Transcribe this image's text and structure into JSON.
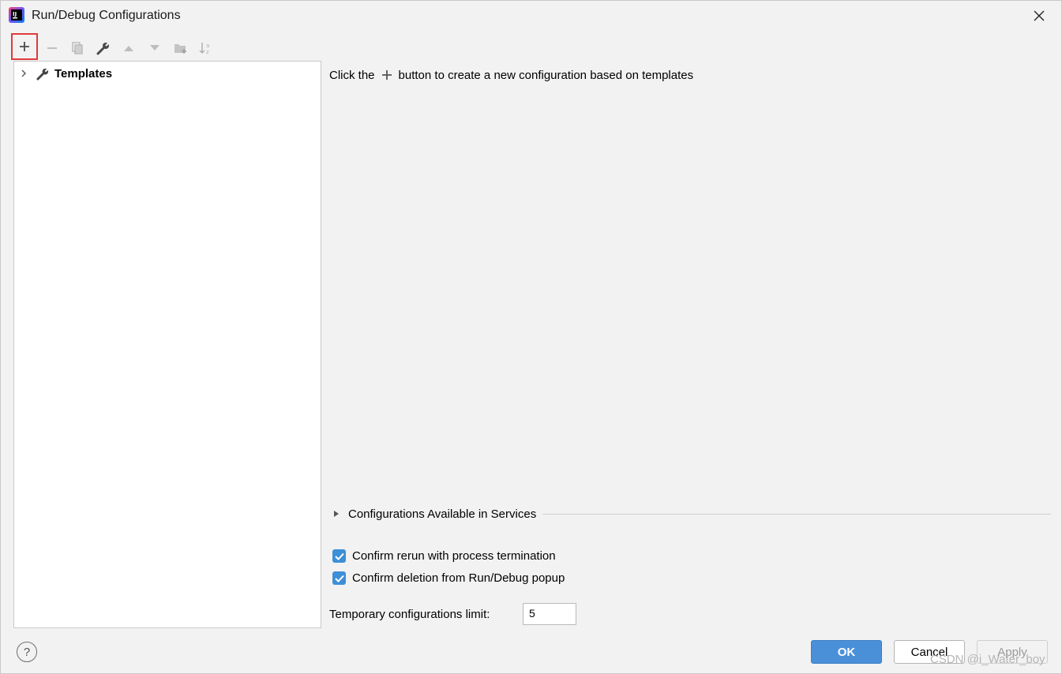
{
  "window": {
    "title": "Run/Debug Configurations"
  },
  "toolbar": {
    "buttons": [
      {
        "name": "add-icon",
        "enabled": true,
        "highlighted": true
      },
      {
        "name": "remove-icon",
        "enabled": false
      },
      {
        "name": "copy-icon",
        "enabled": false
      },
      {
        "name": "wrench-icon",
        "enabled": true
      },
      {
        "name": "move-up-icon",
        "enabled": false
      },
      {
        "name": "move-down-icon",
        "enabled": false
      },
      {
        "name": "new-folder-icon",
        "enabled": false
      },
      {
        "name": "sort-alpha-icon",
        "enabled": false
      }
    ],
    "highlight_color": "#e03a3a"
  },
  "tree": {
    "root_label": "Templates"
  },
  "main": {
    "hint_before": "Click the",
    "hint_after": "button to create a new configuration based on templates",
    "services_label": "Configurations Available in Services",
    "confirm_rerun_label": "Confirm rerun with process termination",
    "confirm_rerun_checked": true,
    "confirm_deletion_label": "Confirm deletion from Run/Debug popup",
    "confirm_deletion_checked": true,
    "temp_limit_label": "Temporary configurations limit:",
    "temp_limit_value": "5"
  },
  "footer": {
    "help_label": "?",
    "ok_label": "OK",
    "cancel_label": "Cancel",
    "apply_label": "Apply",
    "watermark": "CSDN @i_Water_boy"
  },
  "colors": {
    "accent": "#4a90d9",
    "checkbox": "#3d8fd6"
  }
}
